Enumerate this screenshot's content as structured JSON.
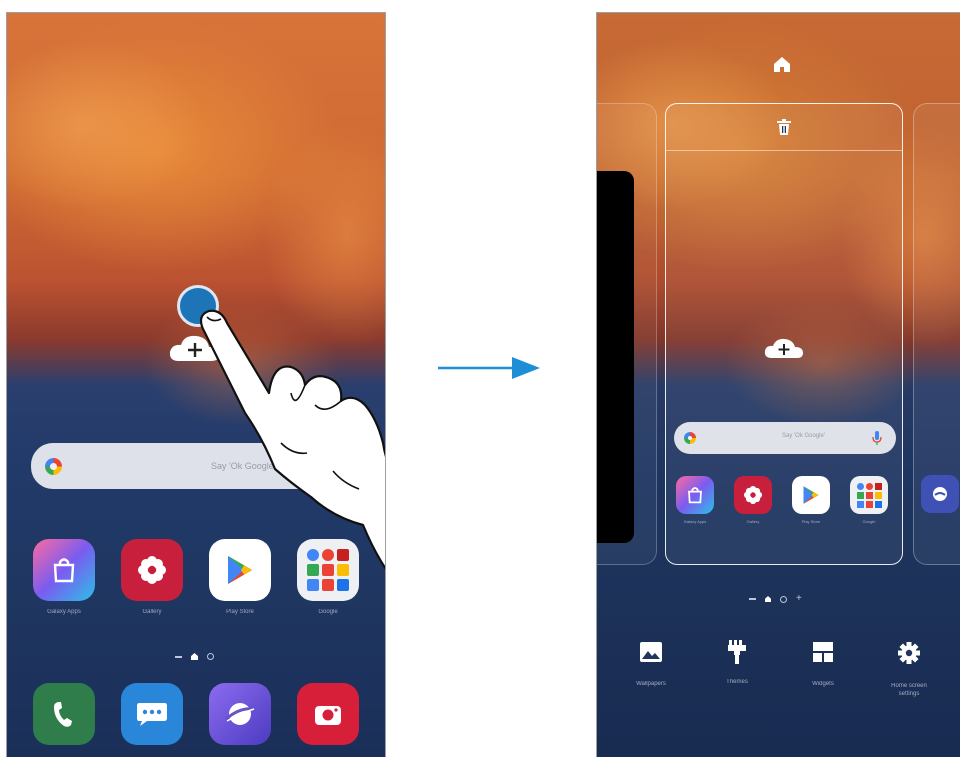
{
  "left_screen": {
    "search": {
      "placeholder": "Say 'Ok Google'"
    },
    "apps": [
      {
        "label": "Galaxy Apps",
        "icon": "galaxy-store-icon",
        "color": "#6a4fd0"
      },
      {
        "label": "Gallery",
        "icon": "gallery-icon",
        "color": "#c8203c"
      },
      {
        "label": "Play Store",
        "icon": "play-store-icon",
        "color": "#ffffff"
      },
      {
        "label": "Google",
        "icon": "google-folder-icon",
        "color": "#ffffff"
      }
    ],
    "dock": [
      {
        "icon": "phone-icon",
        "color": "#2e7d4a"
      },
      {
        "icon": "messages-icon",
        "color": "#2a86d8"
      },
      {
        "icon": "internet-icon",
        "color": "#6a52c8"
      },
      {
        "icon": "camera-icon",
        "color": "#d81f3a"
      }
    ]
  },
  "right_screen": {
    "search": {
      "placeholder": "Say 'Ok Google'"
    },
    "apps": [
      {
        "label": "Galaxy Apps",
        "icon": "galaxy-store-icon"
      },
      {
        "label": "Gallery",
        "icon": "gallery-icon"
      },
      {
        "label": "Play Store",
        "icon": "play-store-icon"
      },
      {
        "label": "Google",
        "icon": "google-folder-icon"
      }
    ],
    "tools": [
      {
        "label": "Wallpapers",
        "icon": "wallpapers-icon"
      },
      {
        "label": "Themes",
        "icon": "themes-icon"
      },
      {
        "label": "Widgets",
        "icon": "widgets-icon"
      },
      {
        "label": "Home screen settings",
        "icon": "settings-icon"
      }
    ]
  },
  "colors": {
    "arrow": "#1e8fd6",
    "accent_dot": "#1d75b8"
  }
}
